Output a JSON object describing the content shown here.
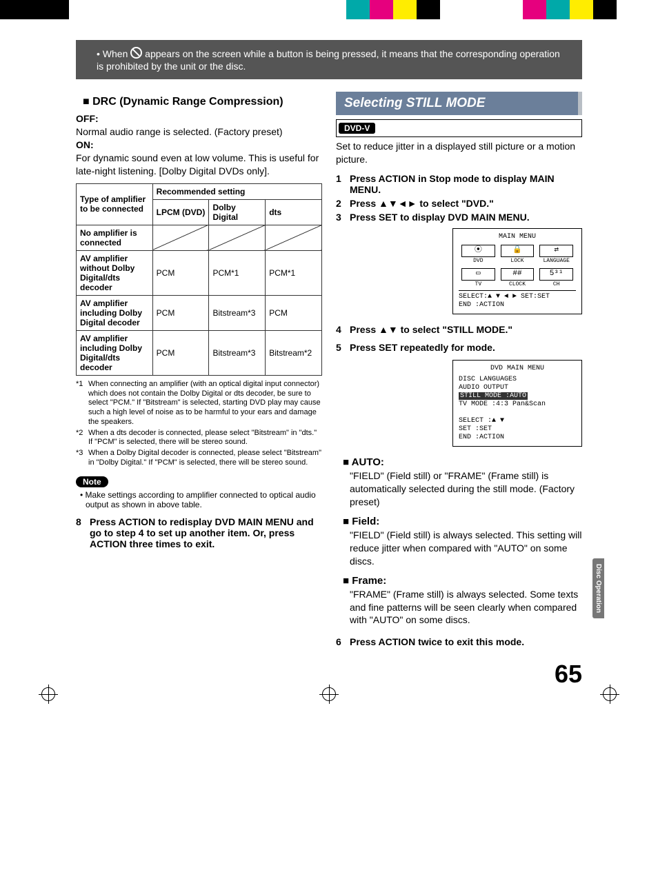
{
  "notice": {
    "pre": "• When ",
    "post": " appears on the screen while a button is being pressed, it means that the corresponding operation is prohibited by the unit or the disc."
  },
  "left": {
    "drc": {
      "heading": "DRC (Dynamic Range Compression)",
      "off_label": "OFF:",
      "off_text": "Normal audio range is selected. (Factory preset)",
      "on_label": "ON:",
      "on_text": "For dynamic sound even at low volume. This is useful for late-night listening. [Dolby Digital DVDs only]."
    },
    "table": {
      "row_header": "Type of amplifier to be connected",
      "rec_header": "Recommended setting",
      "cols": {
        "c1": "LPCM (DVD)",
        "c2": "Dolby Digital",
        "c3": "dts"
      },
      "rows": [
        {
          "h": "No amplifier is connected",
          "c1": "",
          "c2": "",
          "c3": ""
        },
        {
          "h": "AV amplifier without Dolby Digital/dts decoder",
          "c1": "PCM",
          "c2": "PCM*1",
          "c3": "PCM*1"
        },
        {
          "h": "AV amplifier including Dolby Digital decoder",
          "c1": "PCM",
          "c2": "Bitstream*3",
          "c3": "PCM"
        },
        {
          "h": "AV amplifier including Dolby Digital/dts decoder",
          "c1": "PCM",
          "c2": "Bitstream*3",
          "c3": "Bitstream*2"
        }
      ]
    },
    "footnotes": {
      "f1m": "*1",
      "f1": "When connecting an amplifier (with an optical digital input connector) which does not contain the Dolby Digital or dts decoder, be sure to select \"PCM.\" If \"Bitstream\" is selected, starting DVD play may cause such a high level of noise as to be harmful to your ears and damage the speakers.",
      "f2m": "*2",
      "f2": "When a dts decoder is connected, please select \"Bitstream\" in \"dts.\" If \"PCM\" is selected, there will be stereo sound.",
      "f3m": "*3",
      "f3": "When a Dolby Digital decoder is connected, please select \"Bitstream\" in \"Dolby Digital.\" If \"PCM\" is selected, there will be stereo sound."
    },
    "note_label": "Note",
    "note_text": "• Make settings according to amplifier connected to optical audio output as shown in above table.",
    "step8_num": "8",
    "step8": "Press ACTION to redisplay DVD MAIN MENU and go to step 4 to set up another item. Or, press ACTION three times to exit."
  },
  "right": {
    "section_title": "Selecting STILL MODE",
    "badge": "DVD-V",
    "intro": "Set to reduce jitter in a displayed still picture or a motion picture.",
    "steps123": [
      "Press ACTION in Stop mode to display MAIN MENU.",
      "Press ▲▼◄► to select \"DVD.\"",
      "Press SET to display DVD MAIN MENU."
    ],
    "osd1": {
      "title": "MAIN MENU",
      "lbl_dvd": "DVD",
      "lbl_lock": "LOCK",
      "lbl_lang": "LANGUAGE",
      "lbl_tv": "TV",
      "lbl_clock": "CLOCK",
      "lbl_ch": "CH",
      "line1": "SELECT:▲ ▼ ◄ ►  SET:SET",
      "line2": "END   :ACTION"
    },
    "step4_num": "4",
    "step4": "Press ▲▼ to select \"STILL MODE.\"",
    "step5_num": "5",
    "step5": "Press SET repeatedly for mode.",
    "osd2": {
      "title": "DVD MAIN MENU",
      "l1": "DISC LANGUAGES",
      "l2": "AUDIO OUTPUT",
      "l3": "STILL MODE    :AUTO",
      "l4": "TV MODE       :4:3 Pan&Scan",
      "s1": "SELECT   :▲ ▼",
      "s2": "SET      :SET",
      "s3": "END      :ACTION"
    },
    "auto_h": "AUTO:",
    "auto_t": "\"FIELD\" (Field still) or \"FRAME\" (Frame still) is automatically selected during the still mode. (Factory preset)",
    "field_h": "Field:",
    "field_t": "\"FIELD\" (Field still) is always selected. This setting will reduce jitter when compared with \"AUTO\" on some discs.",
    "frame_h": "Frame:",
    "frame_t": "\"FRAME\" (Frame still) is always selected. Some texts and fine patterns will be seen clearly when compared with \"AUTO\" on some discs.",
    "step6_num": "6",
    "step6": "Press ACTION twice to exit this mode."
  },
  "side_tab": "Disc\nOperation",
  "page": "65"
}
